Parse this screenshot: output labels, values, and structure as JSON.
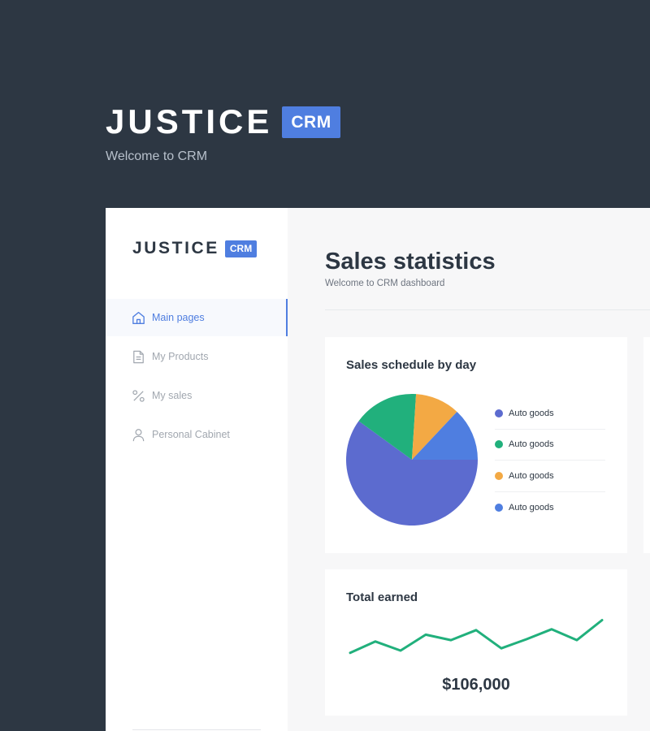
{
  "hero": {
    "brand": "JUSTICE",
    "badge": "CRM",
    "subtitle": "Welcome to CRM"
  },
  "sidebar": {
    "logo": {
      "brand": "JUSTICE",
      "badge": "CRM"
    },
    "items": [
      {
        "label": "Main pages",
        "icon": "home-icon",
        "active": true
      },
      {
        "label": "My Products",
        "icon": "document-icon",
        "active": false
      },
      {
        "label": "My sales",
        "icon": "percent-icon",
        "active": false
      },
      {
        "label": "Personal Cabinet",
        "icon": "user-icon",
        "active": false
      }
    ]
  },
  "main": {
    "title": "Sales statistics",
    "subtitle": "Welcome to CRM dashboard"
  },
  "pie_card": {
    "title": "Sales schedule by day",
    "legend": [
      {
        "label": "Auto goods",
        "color": "#5c6bcf"
      },
      {
        "label": "Auto goods",
        "color": "#21b07c"
      },
      {
        "label": "Auto goods",
        "color": "#f3a944"
      },
      {
        "label": "Auto goods",
        "color": "#4f7ee0"
      }
    ]
  },
  "total_card": {
    "title": "Total earned",
    "value": "$106,000",
    "line_color": "#21b07c"
  },
  "chart_data": [
    {
      "type": "pie",
      "title": "Sales schedule by day",
      "labels": [
        "Auto goods",
        "Auto goods",
        "Auto goods",
        "Auto goods"
      ],
      "values": [
        60,
        16,
        11,
        13
      ],
      "colors": [
        "#5c6bcf",
        "#21b07c",
        "#f3a944",
        "#4f7ee0"
      ]
    },
    {
      "type": "line",
      "title": "Total earned",
      "x": [
        1,
        2,
        3,
        4,
        5,
        6,
        7,
        8,
        9,
        10,
        11
      ],
      "series": [
        {
          "values": [
            2,
            4.5,
            2.5,
            6,
            4.8,
            7,
            3,
            5,
            7.2,
            4.8,
            9.2
          ]
        }
      ]
    }
  ]
}
